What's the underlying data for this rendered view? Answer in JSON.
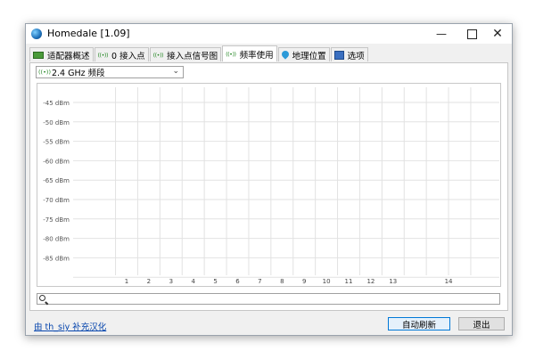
{
  "window": {
    "title": "Homedale [1.09]"
  },
  "tabs": [
    {
      "label": "适配器概述",
      "icon": "adapter-icon"
    },
    {
      "label": "0 接入点",
      "icon": "signal-icon"
    },
    {
      "label": "接入点信号图",
      "icon": "signal-icon"
    },
    {
      "label": "频率使用",
      "icon": "signal-icon",
      "active": true
    },
    {
      "label": "地理位置",
      "icon": "location-pin-icon"
    },
    {
      "label": "选项",
      "icon": "options-icon"
    }
  ],
  "band_select": {
    "value": "2.4 GHz 频段",
    "icon_text": "((•))"
  },
  "chart_data": {
    "type": "line",
    "title": "",
    "xlabel": "",
    "ylabel": "",
    "y_ticks": [
      "-45 dBm",
      "-50 dBm",
      "-55 dBm",
      "-60 dBm",
      "-65 dBm",
      "-70 dBm",
      "-75 dBm",
      "-80 dBm",
      "-85 dBm"
    ],
    "y_values": [
      -45,
      -50,
      -55,
      -60,
      -65,
      -70,
      -75,
      -80,
      -85
    ],
    "x_ticks": [
      "1",
      "2",
      "3",
      "4",
      "5",
      "6",
      "7",
      "8",
      "9",
      "10",
      "11",
      "12",
      "13",
      "14"
    ],
    "grid": true,
    "series": []
  },
  "search": {
    "value": ""
  },
  "footer": {
    "credit_link": "由 th_siy 补充汉化",
    "refresh_label": "自动刷新",
    "exit_label": "退出"
  }
}
